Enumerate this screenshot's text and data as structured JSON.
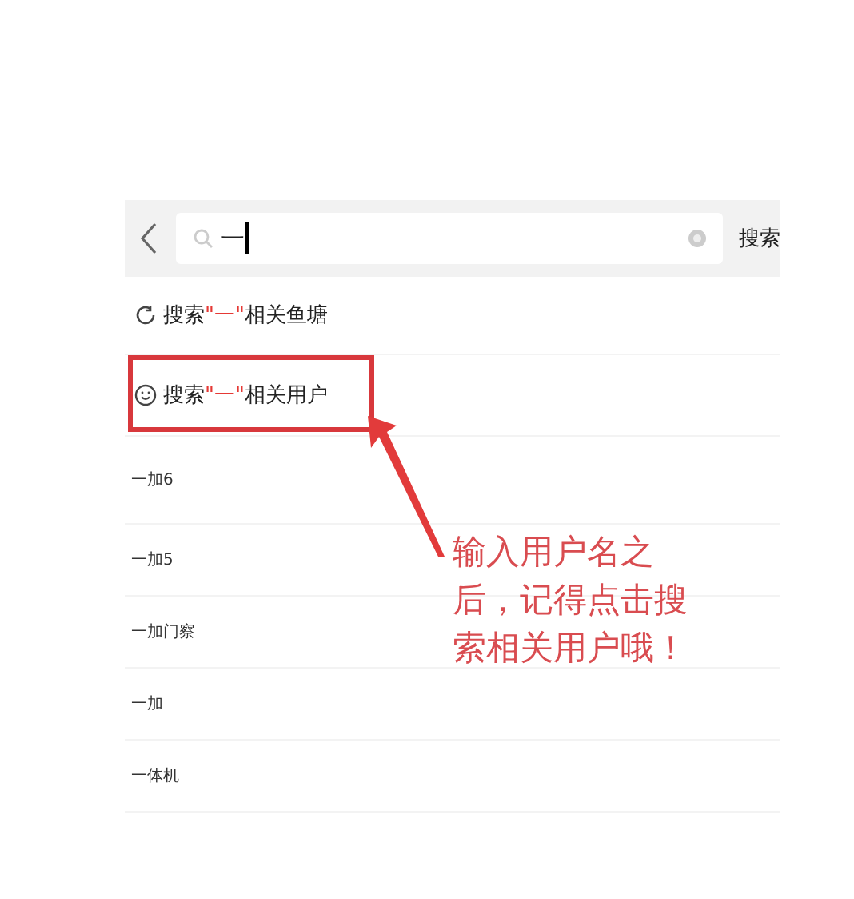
{
  "search_bar": {
    "value": "一",
    "button": "搜索"
  },
  "search_actions": [
    {
      "kind": "pond",
      "prefix": "搜索",
      "keyword": "\"一\"",
      "suffix": "相关鱼塘"
    },
    {
      "kind": "user",
      "prefix": "搜索",
      "keyword": "\"一\"",
      "suffix": "相关用户"
    }
  ],
  "suggestions": [
    "一加6",
    "一加5",
    "一加门察",
    "一加",
    "一体机"
  ],
  "annotation": {
    "text": "输入用户名之后，记得点击搜索相关用户哦！"
  }
}
